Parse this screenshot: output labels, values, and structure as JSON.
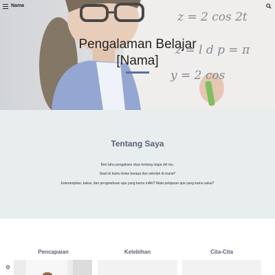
{
  "header": {
    "site_name": "Nama",
    "menu_icon": "menu-icon",
    "search_icon": "search-icon"
  },
  "hero": {
    "title_line1": "Pengalaman Belajar",
    "title_line2": "[Nama]",
    "accent_color": "#5b6aa6",
    "board_text": {
      "line1": "z = 2 cos 2t",
      "line2": "z = l d p = π",
      "line3": "y = 2 cos"
    }
  },
  "about": {
    "heading": "Tentang Saya",
    "line1": "Beri tahu pengakses situs tentang siapa diri mu.",
    "line2": "Saat ini kamu kelas berapa dan sekolah di mana?",
    "line3": "Keterampilan, bakat, dan pengetahuan apa yang kamu miliki? Mata pelajaran apa yang kamu sukai?",
    "background_color": "#e8eeee"
  },
  "sections": [
    {
      "title": "Pencapaian"
    },
    {
      "title": "Kelebihan"
    },
    {
      "title": "Cita-Cita"
    }
  ],
  "footer": {
    "settings_icon": "settings-icon"
  }
}
